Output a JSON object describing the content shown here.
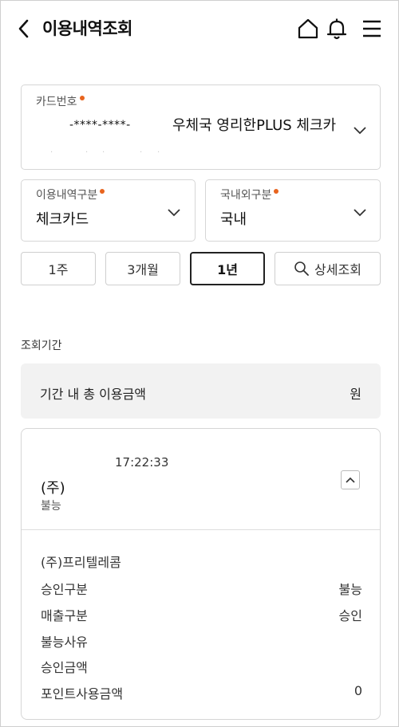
{
  "header": {
    "title": "이용내역조회",
    "icons": [
      "back-arrow-icon",
      "home-icon",
      "bell-icon",
      "menu-icon"
    ]
  },
  "card_field": {
    "label": "카드번호",
    "masked_number": "-****-****-",
    "card_name": "우체국 영리한PLUS 체크카"
  },
  "usage_type": {
    "label": "이용내역구분",
    "value": "체크카드"
  },
  "region": {
    "label": "국내외구분",
    "value": "국내"
  },
  "period_buttons": {
    "week": "1주",
    "three_months": "3개월",
    "year": "1년",
    "detail": "상세조회",
    "selected": "1년"
  },
  "period": {
    "label": "조회기간"
  },
  "total": {
    "label": "기간 내 총 이용금액",
    "unit": "원"
  },
  "transaction": {
    "time": "17:22:33",
    "merchant_short": "(주)",
    "status_short": "불능",
    "merchant_full": "(주)프리텔레콤",
    "details": [
      {
        "label": "승인구분",
        "value": "불능"
      },
      {
        "label": "매출구분",
        "value": "승인"
      },
      {
        "label": "불능사유",
        "value": ""
      },
      {
        "label": "승인금액",
        "value": ""
      },
      {
        "label": "포인트사용금액",
        "value": "0"
      }
    ]
  },
  "colors": {
    "required_dot": "#e8641e",
    "summary_bg": "#f2f2f2",
    "active_border": "#222222"
  }
}
